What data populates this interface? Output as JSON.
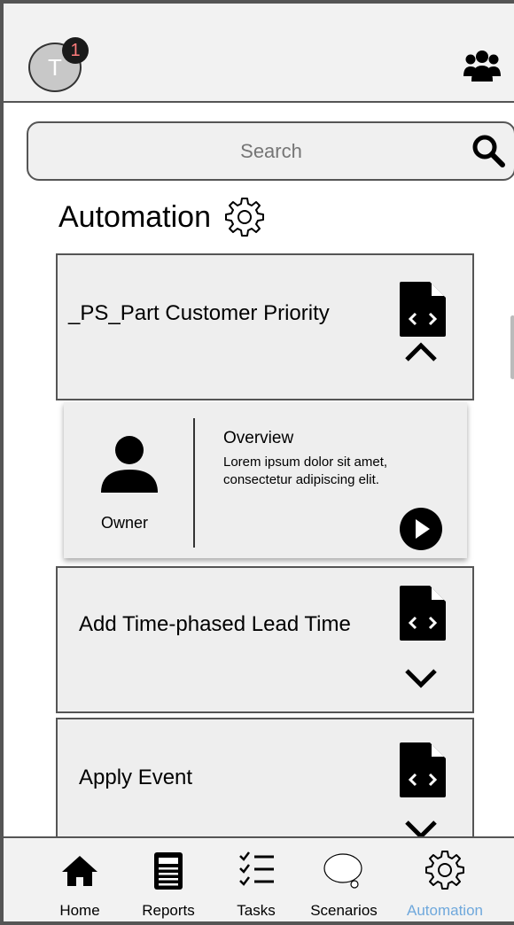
{
  "header": {
    "avatar_initial": "T",
    "notification_count": "1",
    "right_icon": "group-icon"
  },
  "search": {
    "placeholder": "Search",
    "icon": "search-icon"
  },
  "page": {
    "title": "Automation",
    "title_icon": "gear-icon"
  },
  "cards": [
    {
      "title": "_PS_Part Customer Priority",
      "icon": "script-file-icon",
      "expanded": true
    },
    {
      "title": "Add Time-phased Lead Time",
      "icon": "script-file-icon",
      "expanded": false
    },
    {
      "title": "Apply Event",
      "icon": "script-file-icon",
      "expanded": false
    }
  ],
  "detail": {
    "owner_label": "Owner",
    "overview_title": "Overview",
    "overview_text": "Lorem ipsum dolor sit amet, consectetur adipiscing elit.",
    "run_icon": "play-icon"
  },
  "nav": {
    "items": [
      {
        "label": "Home",
        "icon": "home-icon",
        "active": false
      },
      {
        "label": "Reports",
        "icon": "report-icon",
        "active": false
      },
      {
        "label": "Tasks",
        "icon": "tasks-icon",
        "active": false
      },
      {
        "label": "Scenarios",
        "icon": "speech-bubble-icon",
        "active": false
      },
      {
        "label": "Automation",
        "icon": "gear-icon",
        "active": true
      }
    ]
  },
  "colors": {
    "accent_active": "#6fa8dc",
    "card_bg": "#eeeeee",
    "badge_text": "#ff7c7c"
  }
}
